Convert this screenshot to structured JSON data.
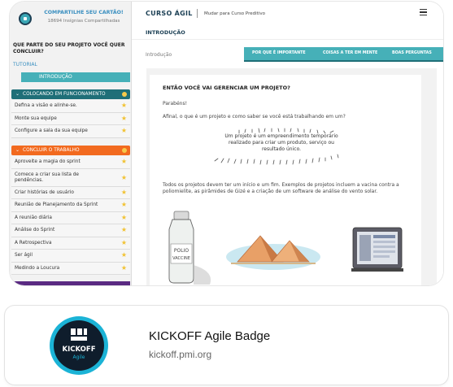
{
  "sidebar": {
    "share_title": "COMPARTILHE SEU CARTÃO!",
    "share_sub": "18694 Insígnias Compartilhadas",
    "question": "QUE PARTE DO SEU PROJETO VOCÊ QUER CONCLUIR?",
    "tutorial": "TUTORIAL",
    "intro": "INTRODUÇÃO",
    "section1": "COLOCANDO EM FUNCIONAMENTO",
    "section1_items": [
      "Defina a visão e alinhe-se.",
      "Monte sua equipe",
      "Configure a sala da sua equipe"
    ],
    "section2": "CONCLUIR O TRABALHO",
    "section2_items": [
      "Aproveite a magia do sprint",
      "Comece a criar sua lista de pendências.",
      "Criar histórias de usuário",
      "Reunião de Planejamento da Sprint",
      "A reunião diária",
      "Análise do Sprint",
      "A Retrospectiva",
      "Ser ágil",
      "Medindo a Loucura"
    ]
  },
  "header": {
    "brand": "CURSO ÁGIL",
    "mode_link": "Mudar para Curso Preditivo",
    "page_heading": "INTRODUÇÃO",
    "crumb": "Introdução",
    "tabs": [
      "POR QUE É IMPORTANTE",
      "COISAS A TER EM MENTE",
      "BOAS PERGUNTAS"
    ]
  },
  "article": {
    "title": "ENTÃO VOCÊ VAI GERENCIAR UM PROJETO?",
    "p1": "Parabéns!",
    "p2": "Afinal, o que é um projeto e como saber se você está trabalhando em um?",
    "quote": "Um projeto é um empreendimento temporário realizado para criar um produto, serviço ou resultado único.",
    "p3": "Todos os projetos devem ter um início e um fim. Exemplos de projetos incluem a vacina contra a poliomielite, as pirâmides de Gizé e a criação de um software de análise do vento solar.",
    "bottle_label_1": "POLIO",
    "bottle_label_2": "VACCINE"
  },
  "link_card": {
    "badge_text": "KICKOFF",
    "badge_sub": "Agile",
    "title": "KICKOFF Agile Badge",
    "url": "kickoff.pmi.org"
  },
  "colors": {
    "teal": "#46b0b8",
    "dark_teal": "#1f6f78",
    "orange": "#f26a1f",
    "navy": "#1b3f54",
    "star": "#f1c232",
    "badge_ring": "#1bb3d6"
  },
  "icons": [
    "avatar-icon",
    "chevron-down-icon",
    "star-icon",
    "menu-icon",
    "pmi-logo-icon"
  ]
}
